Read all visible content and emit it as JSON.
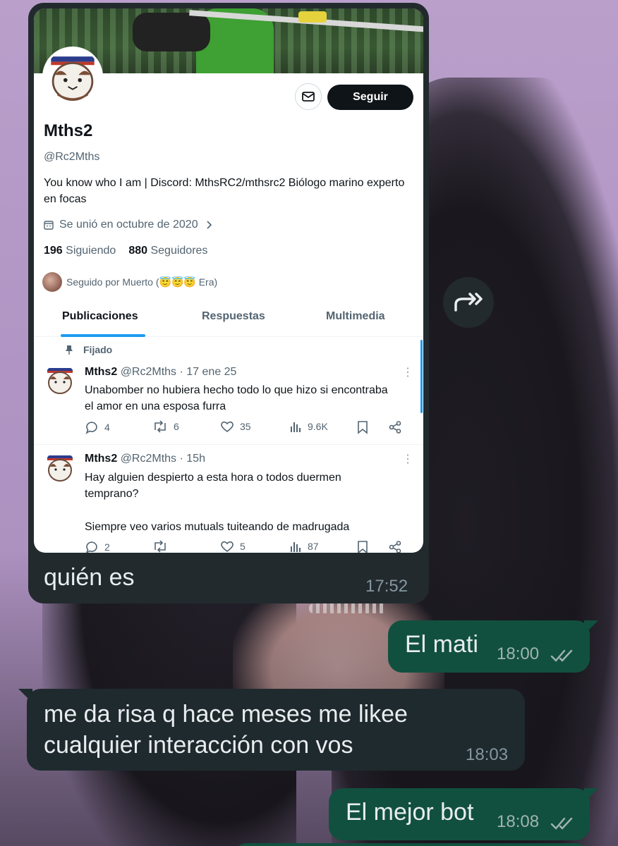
{
  "profile": {
    "display_name": "Mths2",
    "handle": "@Rc2Mths",
    "follow_label": "Seguir",
    "bio": "You know who I am | Discord: MthsRC2/mthsrc2 Biólogo marino experto en focas",
    "joined": "Se unió en octubre de 2020",
    "following_count": "196",
    "following_label": "Siguiendo",
    "followers_count": "880",
    "followers_label": "Seguidores",
    "followed_by": "Seguido por Muerto (😇😇😇 Era)"
  },
  "tabs": [
    "Publicaciones",
    "Respuestas",
    "Multimedia"
  ],
  "pinned_label": "Fijado",
  "tweets": [
    {
      "name": "Mths2",
      "meta": "@Rc2Mths · 17 ene 25",
      "text": "Unabomber no hubiera hecho todo lo que hizo si encontraba el amor en una esposa furra",
      "replies": "4",
      "retweets": "6",
      "likes": "35",
      "views": "9.6K"
    },
    {
      "name": "Mths2",
      "meta": "@Rc2Mths · 15h",
      "text_line1": "Hay alguien despierto a esta hora o todos duermen temprano?",
      "text_line2": "Siempre veo varios mutuals tuiteando de madrugada",
      "replies": "2",
      "retweets": "",
      "likes": "5",
      "views": "87"
    }
  ],
  "chat": {
    "media_caption": "quién es",
    "media_time": "17:52",
    "messages": [
      {
        "dir": "out",
        "text": "El mati",
        "time": "18:00"
      },
      {
        "dir": "in",
        "text": "me da risa q hace meses me likee cualquier interacción con vos",
        "time": "18:03"
      },
      {
        "dir": "out",
        "text": "El mejor bot",
        "time": "18:08"
      }
    ]
  },
  "colors": {
    "outgoing_bubble": "#11503f",
    "incoming_bubble": "#1f2a2e",
    "twitter_blue": "#1d9bf0"
  }
}
